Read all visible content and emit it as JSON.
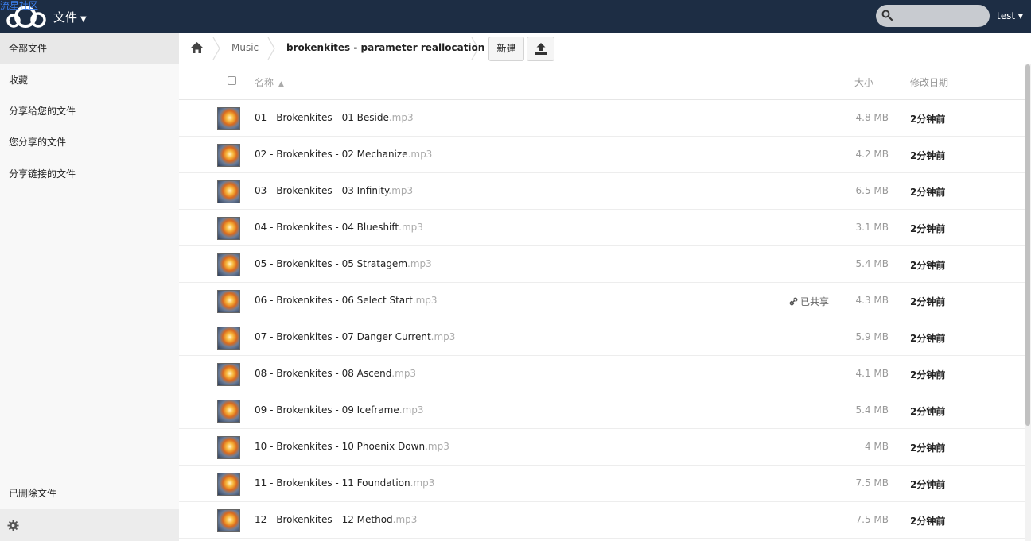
{
  "header": {
    "brand_link": "流星社区",
    "app_title": "文件",
    "search_placeholder": "",
    "user": "test ▾"
  },
  "sidebar": {
    "items": [
      {
        "label": "全部文件"
      },
      {
        "label": "收藏"
      },
      {
        "label": "分享给您的文件"
      },
      {
        "label": "您分享的文件"
      },
      {
        "label": "分享链接的文件"
      }
    ],
    "deleted_label": "已删除文件"
  },
  "breadcrumb": {
    "items": [
      "Music",
      "brokenkites - parameter reallocation"
    ]
  },
  "toolbar": {
    "new_label": "新建"
  },
  "table": {
    "col_name": "名称",
    "col_size": "大小",
    "col_date": "修改日期",
    "shared_label": "已共享",
    "rows": [
      {
        "name": "01 - Brokenkites - 01 Beside",
        "ext": ".mp3",
        "size": "4.8 MB",
        "date": "2分钟前"
      },
      {
        "name": "02 - Brokenkites - 02 Mechanize",
        "ext": ".mp3",
        "size": "4.2 MB",
        "date": "2分钟前"
      },
      {
        "name": "03 - Brokenkites - 03 Infinity",
        "ext": ".mp3",
        "size": "6.5 MB",
        "date": "2分钟前"
      },
      {
        "name": "04 - Brokenkites - 04 Blueshift",
        "ext": ".mp3",
        "size": "3.1 MB",
        "date": "2分钟前"
      },
      {
        "name": "05 - Brokenkites - 05 Stratagem",
        "ext": ".mp3",
        "size": "5.4 MB",
        "date": "2分钟前"
      },
      {
        "name": "06 - Brokenkites - 06 Select Start",
        "ext": ".mp3",
        "size": "4.3 MB",
        "date": "2分钟前",
        "shared": true
      },
      {
        "name": "07 - Brokenkites - 07 Danger Current",
        "ext": ".mp3",
        "size": "5.9 MB",
        "date": "2分钟前"
      },
      {
        "name": "08 - Brokenkites - 08 Ascend",
        "ext": ".mp3",
        "size": "4.1 MB",
        "date": "2分钟前"
      },
      {
        "name": "09 - Brokenkites - 09 Iceframe",
        "ext": ".mp3",
        "size": "5.4 MB",
        "date": "2分钟前"
      },
      {
        "name": "10 - Brokenkites - 10 Phoenix Down",
        "ext": ".mp3",
        "size": "4 MB",
        "date": "2分钟前"
      },
      {
        "name": "11 - Brokenkites - 11 Foundation",
        "ext": ".mp3",
        "size": "7.5 MB",
        "date": "2分钟前"
      },
      {
        "name": "12 - Brokenkites - 12 Method",
        "ext": ".mp3",
        "size": "7.5 MB",
        "date": "2分钟前"
      }
    ]
  },
  "colors": {
    "header_bg": "#1d2d44",
    "sidebar_bg": "#f8f8f8",
    "brand_link": "#3a7ff0"
  },
  "icons": [
    "cloud-logo-icon",
    "search-icon",
    "home-icon",
    "chevron-right-icon",
    "upload-icon",
    "link-icon",
    "gear-icon",
    "sort-up-icon"
  ]
}
